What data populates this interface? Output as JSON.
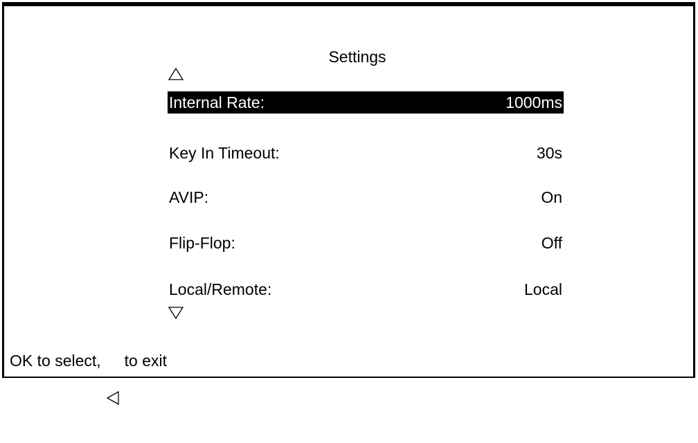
{
  "screen": {
    "title": "Settings"
  },
  "menu": {
    "selected_index": 0,
    "items": [
      {
        "label": "Internal Rate:",
        "value": "1000ms"
      },
      {
        "label": "Key In Timeout:",
        "value": "30s"
      },
      {
        "label": "AVIP:",
        "value": "On"
      },
      {
        "label": "Flip-Flop:",
        "value": "Off"
      },
      {
        "label": "Local/Remote:",
        "value": "Local"
      }
    ],
    "scroll_up_icon": "triangle-up-icon",
    "scroll_down_icon": "triangle-down-icon"
  },
  "footer": {
    "hint_before": "OK to select,",
    "hint_icon": "triangle-left-icon",
    "hint_after": "to exit"
  },
  "colors": {
    "background": "#ffffff",
    "foreground": "#000000",
    "highlight_background": "#000000",
    "highlight_text": "#ffffff"
  }
}
